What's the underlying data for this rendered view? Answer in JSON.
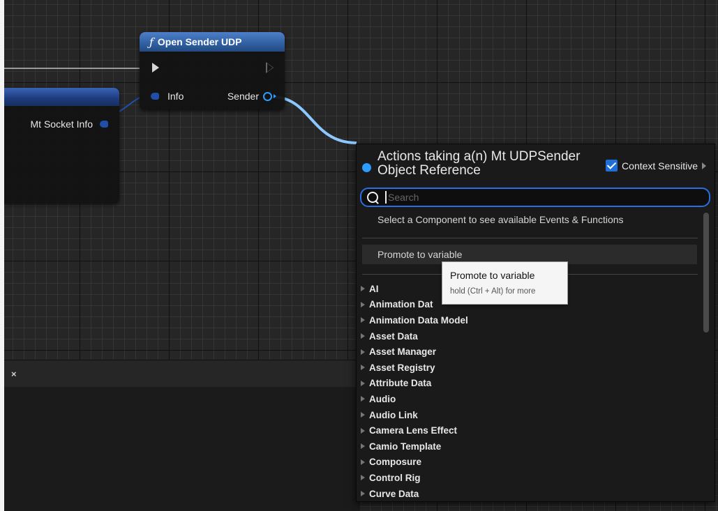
{
  "graph": {
    "left_node": {
      "pin_label": "Mt Socket Info"
    },
    "function_node": {
      "icon": "function-icon",
      "title": "Open Sender UDP",
      "input_label": "Info",
      "output_label": "Sender"
    }
  },
  "bottom_panel": {
    "close_label": "×"
  },
  "action_menu": {
    "title": "Actions taking a(n) Mt UDPSender Object Reference",
    "context_sensitive": {
      "label": "Context Sensitive",
      "checked": true
    },
    "search": {
      "placeholder": "Search",
      "value": ""
    },
    "component_message": "Select a Component to see available Events & Functions",
    "promote_label": "Promote to variable",
    "categories": [
      "AI",
      "Animation Dat",
      "Animation Data Model",
      "Asset Data",
      "Asset Manager",
      "Asset Registry",
      "Attribute Data",
      "Audio",
      "Audio Link",
      "Camera Lens Effect",
      "Camio Template",
      "Composure",
      "Control Rig",
      "Curve Data"
    ]
  },
  "tooltip": {
    "title": "Promote to variable",
    "hint": "hold (Ctrl + Alt) for more"
  },
  "colors": {
    "accent": "#2d9cff",
    "node_header": "#2c5a9a",
    "background": "#262626"
  }
}
